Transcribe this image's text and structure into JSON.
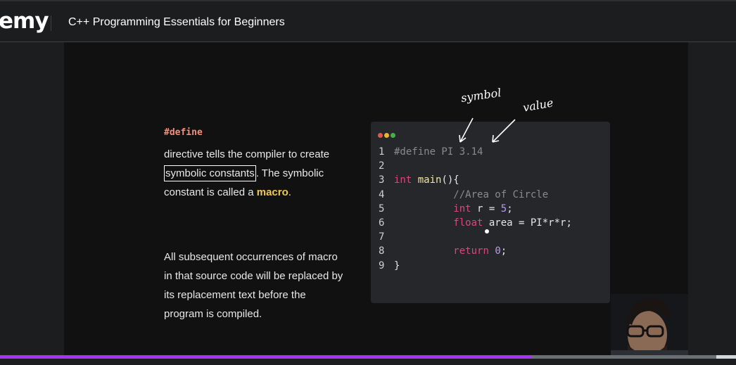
{
  "header": {
    "logo_text": "emy",
    "course_title": "C++ Programming Essentials for Beginners"
  },
  "slide": {
    "define_keyword": "#define",
    "para1": {
      "part1": "directive tells the compiler to create ",
      "boxed": "symbolic constants",
      "part2": ". The symbolic constant is called a ",
      "macro": "macro",
      "part3": "."
    },
    "para2": "All subsequent occurrences of macro in that source code will be replaced by its replacement text before the program is compiled.",
    "annotations": {
      "symbol": "symbol",
      "value": "value"
    },
    "code_lines": [
      {
        "n": "1",
        "text": "#define PI 3.14"
      },
      {
        "n": "2",
        "text": ""
      },
      {
        "n": "3",
        "text": "int main(){"
      },
      {
        "n": "4",
        "text": "//Area of Circle"
      },
      {
        "n": "5",
        "text": "int r = 5;"
      },
      {
        "n": "6",
        "text": "float area = PI*r*r;"
      },
      {
        "n": "7",
        "text": ""
      },
      {
        "n": "8",
        "text": "return 0;"
      },
      {
        "n": "9",
        "text": "}"
      }
    ],
    "window_dot_colors": [
      "#e0574f",
      "#e8b531",
      "#43b04a"
    ]
  },
  "player": {
    "progress_fraction": 0.722,
    "progress_color": "#a435f0"
  }
}
